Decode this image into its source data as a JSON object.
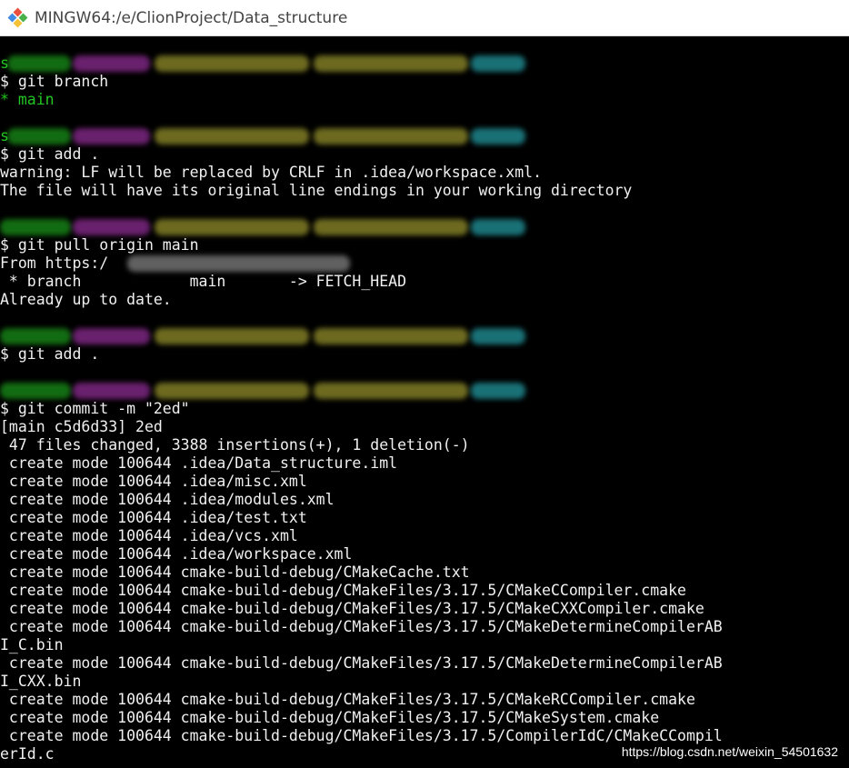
{
  "window": {
    "title": "MINGW64:/e/ClionProject/Data_structure",
    "icon": "git-bash-icon"
  },
  "terminal": {
    "colors": {
      "background": "#000000",
      "text": "#f0f0f0",
      "user": "#22c522",
      "host": "#c03cc8",
      "path": "#c7c23a",
      "branch": "#2ecdd6"
    },
    "lines": [
      {
        "kind": "prompt",
        "visible": "s"
      },
      {
        "kind": "cmd",
        "text": "$ git branch"
      },
      {
        "kind": "green",
        "text": "* main"
      },
      {
        "kind": "blank",
        "text": ""
      },
      {
        "kind": "prompt",
        "visible": "s"
      },
      {
        "kind": "cmd",
        "text": "$ git add ."
      },
      {
        "kind": "out",
        "text": "warning: LF will be replaced by CRLF in .idea/workspace.xml."
      },
      {
        "kind": "out",
        "text": "The file will have its original line endings in your working directory"
      },
      {
        "kind": "blank",
        "text": ""
      },
      {
        "kind": "prompt",
        "visible": ""
      },
      {
        "kind": "cmd",
        "text": "$ git pull origin main"
      },
      {
        "kind": "out",
        "text": "From https:/"
      },
      {
        "kind": "out",
        "text": " * branch            main       -> FETCH_HEAD"
      },
      {
        "kind": "out",
        "text": "Already up to date."
      },
      {
        "kind": "blank",
        "text": ""
      },
      {
        "kind": "prompt",
        "visible": ""
      },
      {
        "kind": "cmd",
        "text": "$ git add ."
      },
      {
        "kind": "blank",
        "text": ""
      },
      {
        "kind": "prompt",
        "visible": ""
      },
      {
        "kind": "cmd",
        "text": "$ git commit -m \"2ed\""
      },
      {
        "kind": "out",
        "text": "[main c5d6d33] 2ed"
      },
      {
        "kind": "out",
        "text": " 47 files changed, 3388 insertions(+), 1 deletion(-)"
      },
      {
        "kind": "out",
        "text": " create mode 100644 .idea/Data_structure.iml"
      },
      {
        "kind": "out",
        "text": " create mode 100644 .idea/misc.xml"
      },
      {
        "kind": "out",
        "text": " create mode 100644 .idea/modules.xml"
      },
      {
        "kind": "out",
        "text": " create mode 100644 .idea/test.txt"
      },
      {
        "kind": "out",
        "text": " create mode 100644 .idea/vcs.xml"
      },
      {
        "kind": "out",
        "text": " create mode 100644 .idea/workspace.xml"
      },
      {
        "kind": "out",
        "text": " create mode 100644 cmake-build-debug/CMakeCache.txt"
      },
      {
        "kind": "out",
        "text": " create mode 100644 cmake-build-debug/CMakeFiles/3.17.5/CMakeCCompiler.cmake"
      },
      {
        "kind": "out",
        "text": " create mode 100644 cmake-build-debug/CMakeFiles/3.17.5/CMakeCXXCompiler.cmake"
      },
      {
        "kind": "out",
        "text": " create mode 100644 cmake-build-debug/CMakeFiles/3.17.5/CMakeDetermineCompilerAB"
      },
      {
        "kind": "out",
        "text": "I_C.bin"
      },
      {
        "kind": "out",
        "text": " create mode 100644 cmake-build-debug/CMakeFiles/3.17.5/CMakeDetermineCompilerAB"
      },
      {
        "kind": "out",
        "text": "I_CXX.bin"
      },
      {
        "kind": "out",
        "text": " create mode 100644 cmake-build-debug/CMakeFiles/3.17.5/CMakeRCCompiler.cmake"
      },
      {
        "kind": "out",
        "text": " create mode 100644 cmake-build-debug/CMakeFiles/3.17.5/CMakeSystem.cmake"
      },
      {
        "kind": "out",
        "text": " create mode 100644 cmake-build-debug/CMakeFiles/3.17.5/CompilerIdC/CMakeCCompil"
      },
      {
        "kind": "out",
        "text": "erId.c"
      }
    ]
  },
  "watermark": "https://blog.csdn.net/weixin_54501632"
}
